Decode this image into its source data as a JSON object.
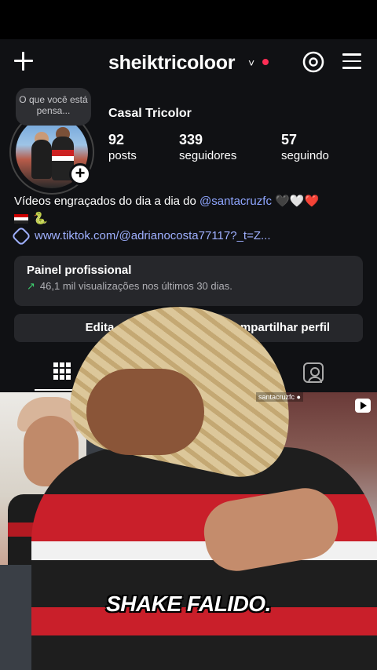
{
  "header": {
    "username": "sheiktricoloor",
    "chevron": "˅",
    "threads_icon": "@",
    "icons": [
      "plus-icon",
      "threads-icon",
      "menu-icon"
    ]
  },
  "profile": {
    "note": "O que você está pensa...",
    "display_name": "Casal Tricolor",
    "stats": [
      {
        "num": "92",
        "label": "posts"
      },
      {
        "num": "339",
        "label": "seguidores"
      },
      {
        "num": "57",
        "label": "seguindo"
      }
    ],
    "bio_text": "Vídeos engraçados do dia a dia do ",
    "bio_mention": "@santacruzfc",
    "bio_hearts": " 🖤🤍❤️",
    "bio_line2_emoji": "🐍",
    "link": "www.tiktok.com/@adrianocosta77117?_t=Z..."
  },
  "pro_panel": {
    "title": "Painel profissional",
    "arrow": "↗",
    "subtitle": "46,1 mil visualizações nos últimos 30 dias."
  },
  "buttons": {
    "edit": "Edita",
    "share": "Compartilhar perfil"
  },
  "video": {
    "handle": "santacruzfc ●",
    "caption": "SHAKE FALIDO."
  }
}
